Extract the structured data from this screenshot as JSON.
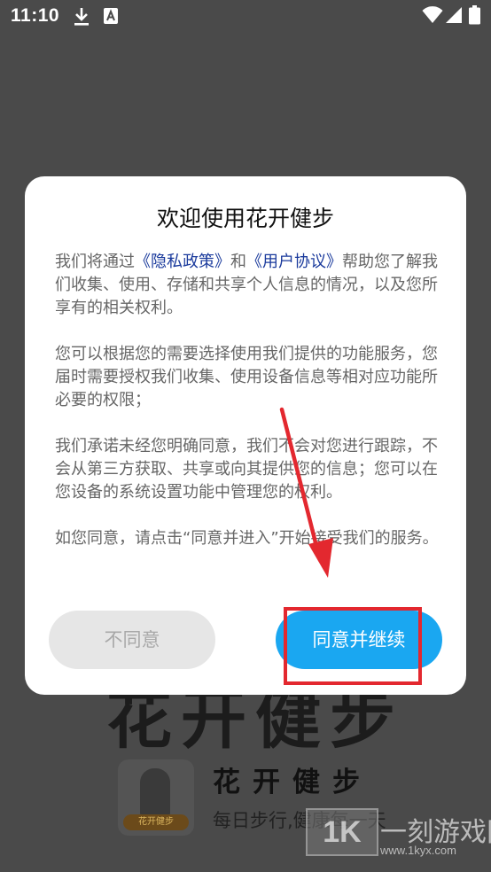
{
  "status_bar": {
    "time": "11:10"
  },
  "background": {
    "big_title": "花开健步",
    "app_name": "花开健步",
    "tagline": "每日步行,健康每一天",
    "logo_text": "花开健步"
  },
  "dialog": {
    "title": "欢迎使用花开健步",
    "p1": {
      "pre": "我们将通过",
      "privacy_link": "《隐私政策》",
      "mid": "和",
      "agreement_link": "《用户协议》",
      "post": "帮助您了解我们收集、使用、存储和共享个人信息的情况，以及您所享有的相关权利。"
    },
    "p2": "您可以根据您的需要选择使用我们提供的功能服务，您届时需要授权我们收集、使用设备信息等相对应功能所必要的权限；",
    "p3": "我们承诺未经您明确同意，我们不会对您进行跟踪，不会从第三方获取、共享或向其提供您的信息；您可以在您设备的系统设置功能中管理您的权利。",
    "p4": "如您同意，请点击“同意并进入”开始接受我们的服务。",
    "disagree_label": "不同意",
    "agree_label": "同意并继续"
  },
  "watermark": {
    "box": "1K",
    "site": "一刻游戏网",
    "url": "www.1kyx.com"
  },
  "colors": {
    "accent": "#1aa7f1",
    "link": "#1a3a9c",
    "annotation": "#e3282f",
    "overlay": "#4a4a4a"
  }
}
